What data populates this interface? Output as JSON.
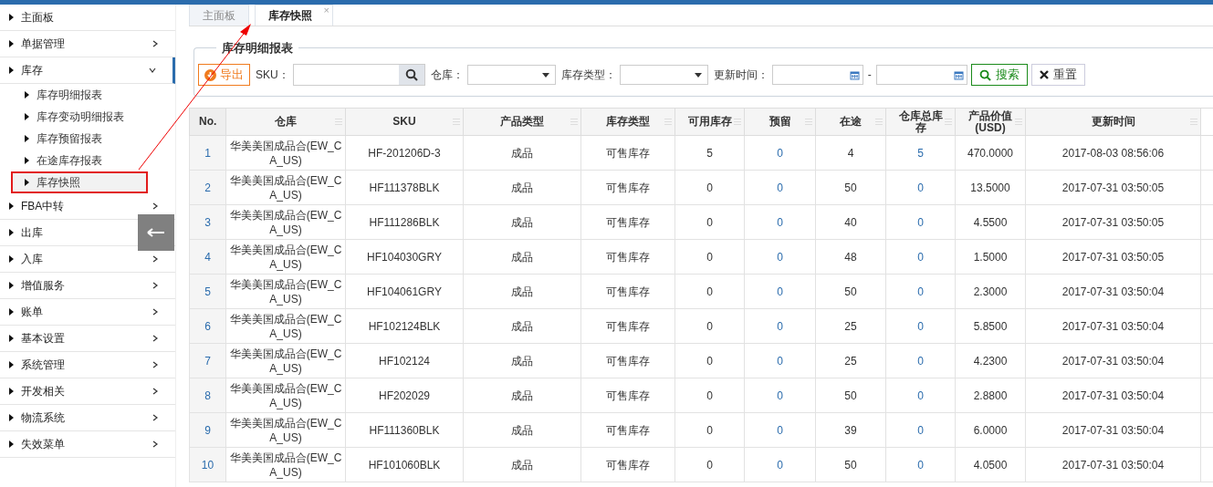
{
  "sidebar": {
    "items": [
      {
        "label": "主面板",
        "kind": "leaf"
      },
      {
        "label": "单据管理",
        "kind": "menu",
        "expanded": false
      },
      {
        "label": "库存",
        "kind": "menu",
        "expanded": true,
        "children": [
          {
            "label": "库存明细报表",
            "selected": false
          },
          {
            "label": "库存变动明细报表",
            "selected": false
          },
          {
            "label": "库存预留报表",
            "selected": false
          },
          {
            "label": "在途库存报表",
            "selected": false
          },
          {
            "label": "库存快照",
            "selected": true
          }
        ]
      },
      {
        "label": "FBA中转",
        "kind": "menu",
        "expanded": false
      },
      {
        "label": "出库",
        "kind": "leaf"
      },
      {
        "label": "入库",
        "kind": "menu",
        "expanded": false
      },
      {
        "label": "增值服务",
        "kind": "menu",
        "expanded": false
      },
      {
        "label": "账单",
        "kind": "menu",
        "expanded": false
      },
      {
        "label": "基本设置",
        "kind": "menu",
        "expanded": false
      },
      {
        "label": "系统管理",
        "kind": "menu",
        "expanded": false
      },
      {
        "label": "开发相关",
        "kind": "menu",
        "expanded": false
      },
      {
        "label": "物流系统",
        "kind": "menu",
        "expanded": false
      },
      {
        "label": "失效菜单",
        "kind": "menu",
        "expanded": false
      }
    ]
  },
  "tabs": [
    {
      "label": "主面板",
      "selected": false
    },
    {
      "label": "库存快照",
      "selected": true,
      "close": "×"
    }
  ],
  "panel": {
    "title": "库存明细报表",
    "export_button": "导出",
    "filters": [
      {
        "kind": "search",
        "label": "SKU："
      },
      {
        "kind": "select",
        "label": "仓库："
      },
      {
        "kind": "select",
        "label": "库存类型："
      },
      {
        "kind": "date_range",
        "label": "更新时间：",
        "separator": "-"
      }
    ],
    "search_button": "搜索",
    "reset_button": "重置"
  },
  "table": {
    "columns": [
      {
        "label": "No.",
        "kind": "index"
      },
      {
        "label": "仓库",
        "kind": "text"
      },
      {
        "label": "SKU",
        "kind": "text"
      },
      {
        "label": "产品类型",
        "kind": "text"
      },
      {
        "label": "库存类型",
        "kind": "text"
      },
      {
        "label": "可用库存",
        "kind": "text"
      },
      {
        "label": "预留",
        "kind": "link"
      },
      {
        "label": "在途",
        "kind": "text"
      },
      {
        "label": "仓库总库存",
        "kind": "link"
      },
      {
        "label": "产品价值\n(USD)",
        "kind": "text"
      },
      {
        "label": "更新时间",
        "kind": "text"
      }
    ],
    "rows": [
      [
        "1",
        "华美美国成品合(EW_CA_US)",
        "HF-201206D-3",
        "成品",
        "可售库存",
        "5",
        "0",
        "4",
        "5",
        "470.0000",
        "2017-08-03 08:56:06"
      ],
      [
        "2",
        "华美美国成品合(EW_CA_US)",
        "HF111378BLK",
        "成品",
        "可售库存",
        "0",
        "0",
        "50",
        "0",
        "13.5000",
        "2017-07-31 03:50:05"
      ],
      [
        "3",
        "华美美国成品合(EW_CA_US)",
        "HF111286BLK",
        "成品",
        "可售库存",
        "0",
        "0",
        "40",
        "0",
        "4.5500",
        "2017-07-31 03:50:05"
      ],
      [
        "4",
        "华美美国成品合(EW_CA_US)",
        "HF104030GRY",
        "成品",
        "可售库存",
        "0",
        "0",
        "48",
        "0",
        "1.5000",
        "2017-07-31 03:50:05"
      ],
      [
        "5",
        "华美美国成品合(EW_CA_US)",
        "HF104061GRY",
        "成品",
        "可售库存",
        "0",
        "0",
        "50",
        "0",
        "2.3000",
        "2017-07-31 03:50:04"
      ],
      [
        "6",
        "华美美国成品合(EW_CA_US)",
        "HF102124BLK",
        "成品",
        "可售库存",
        "0",
        "0",
        "25",
        "0",
        "5.8500",
        "2017-07-31 03:50:04"
      ],
      [
        "7",
        "华美美国成品合(EW_CA_US)",
        "HF102124",
        "成品",
        "可售库存",
        "0",
        "0",
        "25",
        "0",
        "4.2300",
        "2017-07-31 03:50:04"
      ],
      [
        "8",
        "华美美国成品合(EW_CA_US)",
        "HF202029",
        "成品",
        "可售库存",
        "0",
        "0",
        "50",
        "0",
        "2.8800",
        "2017-07-31 03:50:04"
      ],
      [
        "9",
        "华美美国成品合(EW_CA_US)",
        "HF111360BLK",
        "成品",
        "可售库存",
        "0",
        "0",
        "39",
        "0",
        "6.0000",
        "2017-07-31 03:50:04"
      ],
      [
        "10",
        "华美美国成品合(EW_CA_US)",
        "HF101060BLK",
        "成品",
        "可售库存",
        "0",
        "0",
        "50",
        "0",
        "4.0500",
        "2017-07-31 03:50:04"
      ]
    ]
  }
}
